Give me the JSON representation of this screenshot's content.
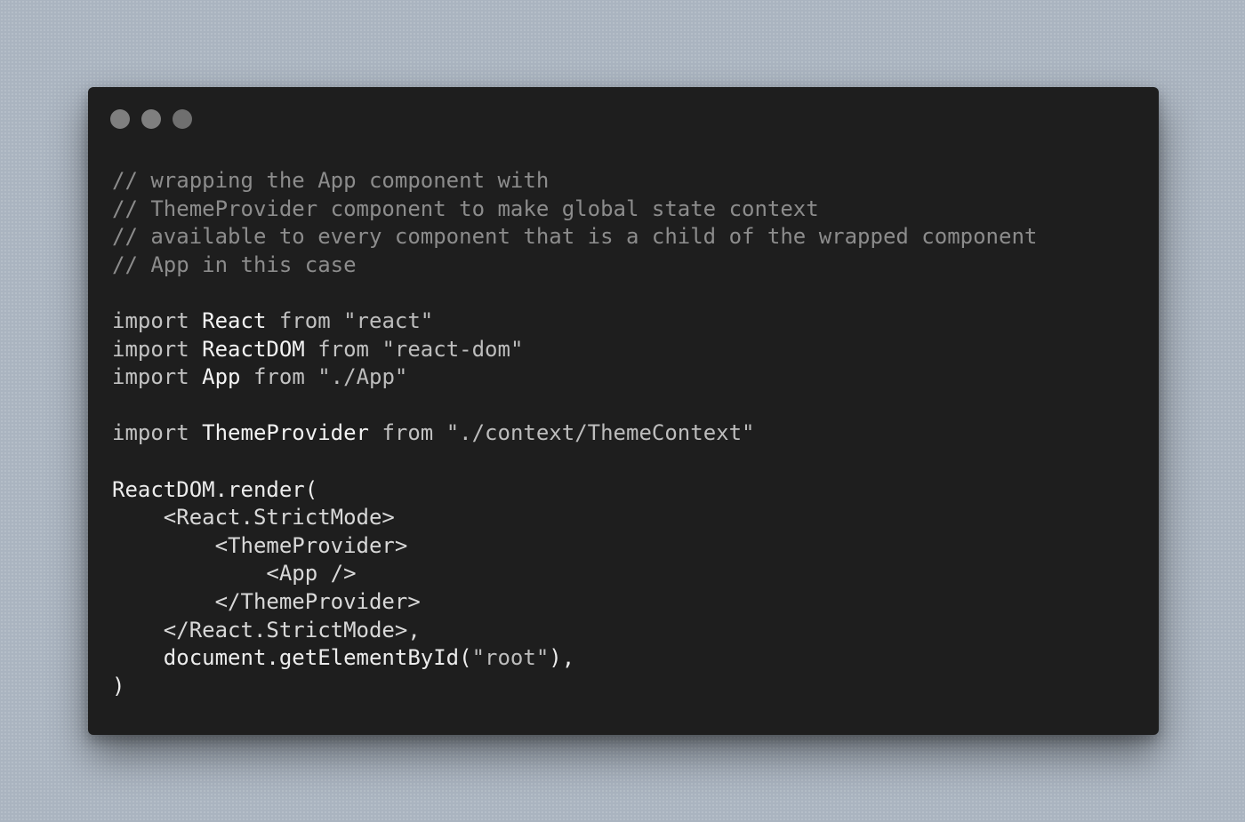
{
  "window": {
    "controls": [
      {
        "name": "close",
        "color": "#7f7f7f"
      },
      {
        "name": "minimize",
        "color": "#7f7f7f"
      },
      {
        "name": "zoom",
        "color": "#6f6f6f"
      }
    ]
  },
  "code": {
    "lines": [
      [
        {
          "t": "// wrapping the App component with",
          "k": "comment"
        }
      ],
      [
        {
          "t": "// ThemeProvider component to make global state context",
          "k": "comment"
        }
      ],
      [
        {
          "t": "// available to every component that is a child of the wrapped component",
          "k": "comment"
        }
      ],
      [
        {
          "t": "// App in this case",
          "k": "comment"
        }
      ],
      [],
      [
        {
          "t": "import",
          "k": "keyword"
        },
        {
          "t": " ",
          "k": "plain"
        },
        {
          "t": "React",
          "k": "ident"
        },
        {
          "t": " ",
          "k": "plain"
        },
        {
          "t": "from",
          "k": "keyword"
        },
        {
          "t": " ",
          "k": "plain"
        },
        {
          "t": "\"react\"",
          "k": "string"
        }
      ],
      [
        {
          "t": "import",
          "k": "keyword"
        },
        {
          "t": " ",
          "k": "plain"
        },
        {
          "t": "ReactDOM",
          "k": "ident"
        },
        {
          "t": " ",
          "k": "plain"
        },
        {
          "t": "from",
          "k": "keyword"
        },
        {
          "t": " ",
          "k": "plain"
        },
        {
          "t": "\"react-dom\"",
          "k": "string"
        }
      ],
      [
        {
          "t": "import",
          "k": "keyword"
        },
        {
          "t": " ",
          "k": "plain"
        },
        {
          "t": "App",
          "k": "ident"
        },
        {
          "t": " ",
          "k": "plain"
        },
        {
          "t": "from",
          "k": "keyword"
        },
        {
          "t": " ",
          "k": "plain"
        },
        {
          "t": "\"./App\"",
          "k": "string"
        }
      ],
      [],
      [
        {
          "t": "import",
          "k": "keyword"
        },
        {
          "t": " ",
          "k": "plain"
        },
        {
          "t": "ThemeProvider",
          "k": "ident"
        },
        {
          "t": " ",
          "k": "plain"
        },
        {
          "t": "from",
          "k": "keyword"
        },
        {
          "t": " ",
          "k": "plain"
        },
        {
          "t": "\"./context/ThemeContext\"",
          "k": "string"
        }
      ],
      [],
      [
        {
          "t": "ReactDOM.render(",
          "k": "plain"
        }
      ],
      [
        {
          "t": "    <React.StrictMode>",
          "k": "tag"
        }
      ],
      [
        {
          "t": "        <ThemeProvider>",
          "k": "tag"
        }
      ],
      [
        {
          "t": "            <App />",
          "k": "tag"
        }
      ],
      [
        {
          "t": "        </ThemeProvider>",
          "k": "tag"
        }
      ],
      [
        {
          "t": "    </React.StrictMode>,",
          "k": "tag"
        }
      ],
      [
        {
          "t": "    document.getElementById(",
          "k": "plain"
        },
        {
          "t": "\"root\"",
          "k": "string"
        },
        {
          "t": "),",
          "k": "plain"
        }
      ],
      [
        {
          "t": ")",
          "k": "plain"
        }
      ]
    ]
  }
}
